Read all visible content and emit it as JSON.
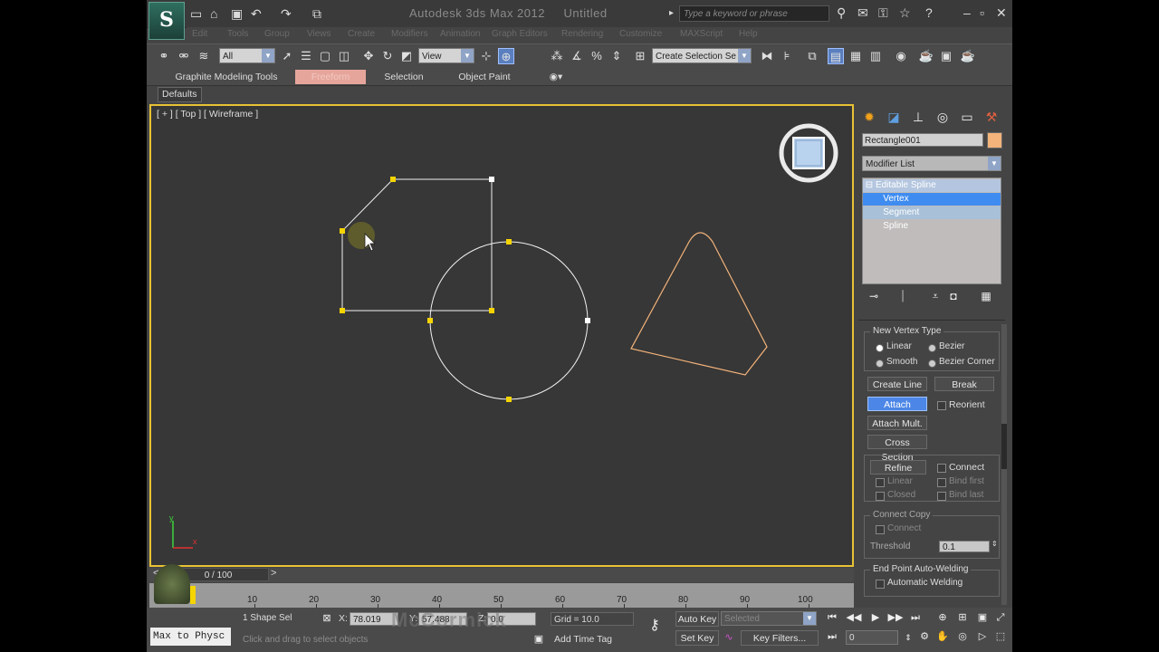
{
  "titlebar": {
    "app_name": "Autodesk 3ds Max  2012",
    "document": "Untitled",
    "search_placeholder": "Type a keyword or phrase",
    "logo": "3ds-max-logo"
  },
  "menu": [
    "Edit",
    "Tools",
    "Group",
    "Views",
    "Create",
    "Modifiers",
    "Animation",
    "Graph Editors",
    "Rendering",
    "Customize",
    "MAXScript",
    "Help"
  ],
  "toolbar": {
    "selection_filter": "All",
    "ref_coord": "View",
    "named_selection": "Create Selection Se"
  },
  "ribbon": {
    "tabs": [
      "Graphite Modeling Tools",
      "Freeform",
      "Selection",
      "Object Paint"
    ],
    "active_tab": 1,
    "defaults_label": "Defaults"
  },
  "viewport": {
    "label": "[ + ] [ Top ] [ Wireframe ]",
    "accent": "#e8c234"
  },
  "command_panel": {
    "object_name": "Rectangle001",
    "object_color": "#f4b37a",
    "modifier_list": "Modifier List",
    "stack": [
      "Editable Spline",
      "Vertex",
      "Segment",
      "Spline"
    ],
    "selected_stack_item": "Vertex"
  },
  "geometry_rollout": {
    "new_vertex_type_title": "New Vertex Type",
    "vertex_types": [
      "Linear",
      "Bezier",
      "Smooth",
      "Bezier Corner"
    ],
    "create_line": "Create Line",
    "break": "Break",
    "attach": "Attach",
    "reorient": "Reorient",
    "attach_mult": "Attach Mult.",
    "cross_section": "Cross Section",
    "refine": "Refine",
    "connect": "Connect",
    "linear": "Linear",
    "bind_first": "Bind first",
    "closed": "Closed",
    "bind_last": "Bind last",
    "connect_copy_title": "Connect Copy",
    "connect_copy": "Connect",
    "threshold_label": "Threshold",
    "threshold_value": "0.1",
    "auto_weld_title": "End Point Auto-Welding",
    "automatic_welding": "Automatic Welding"
  },
  "timeline": {
    "frame_display": "0 / 100",
    "ticks": [
      "10",
      "20",
      "30",
      "40",
      "50",
      "60",
      "70",
      "80",
      "90",
      "100"
    ]
  },
  "statusbar": {
    "maxscript_prompt": "Max to Physc",
    "selection_info": "1 Shape Sel",
    "hint": "Click and drag to select objects",
    "x_label": "X:",
    "x_value": "78.019",
    "y_label": "Y:",
    "y_value": "57.488",
    "z_label": "Z:",
    "z_value": "0.0",
    "grid": "Grid = 10.0",
    "add_time_tag": "Add Time Tag",
    "auto_key": "Auto Key",
    "set_key": "Set Key",
    "key_mode": "Selected",
    "key_filters": "Key Filters...",
    "current_frame": "0",
    "watermark": "McCormick"
  }
}
